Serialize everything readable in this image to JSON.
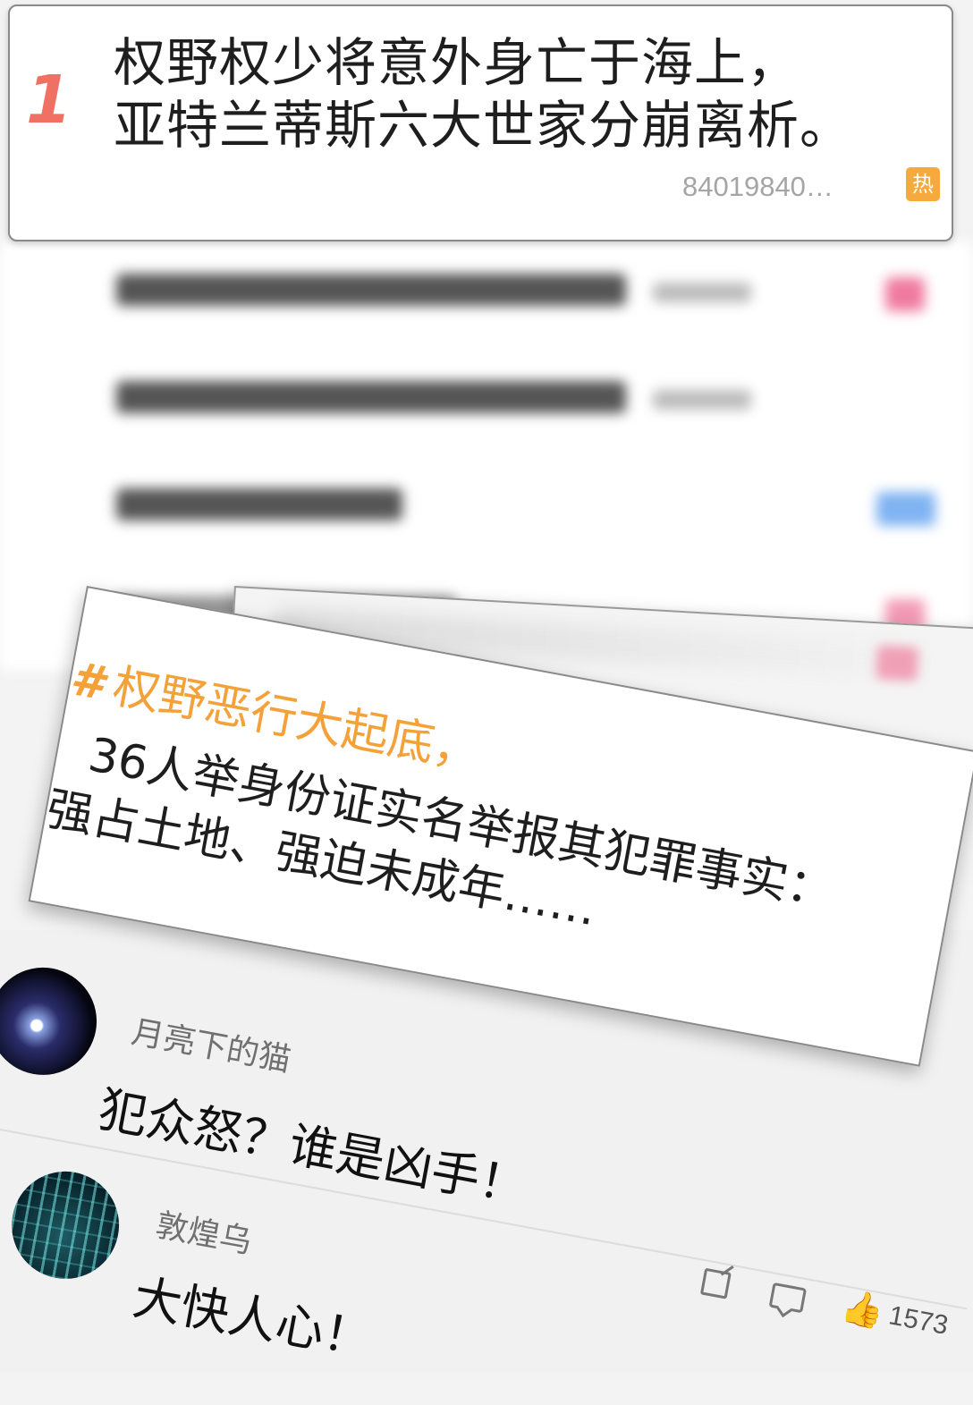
{
  "hot_search_top": {
    "rank": "1",
    "headline_line1": "权野权少将意外身亡于海上，",
    "headline_line2": "亚特兰蒂斯六大世家分崩离析。",
    "count": "84019840…",
    "badge": "热"
  },
  "topic_card": {
    "hash": "#",
    "tag": "权野恶行大起底，",
    "line1": "36人举身份证实名举报其犯罪事实：",
    "line2": "强占土地、强迫未成年……"
  },
  "comments": [
    {
      "username": "月亮下的猫",
      "text": "犯众怒？谁是凶手！"
    },
    {
      "username": "敦煌乌",
      "text": "大快人心！"
    }
  ],
  "actions": {
    "share_icon": "share-icon",
    "comment_icon": "comment-icon",
    "like_icon": "thumbs-up-icon",
    "like_count": "1573"
  },
  "colors": {
    "rank_red": "#f07063",
    "hot_badge": "#f6a93d",
    "topic_orange": "#f5a13a"
  }
}
